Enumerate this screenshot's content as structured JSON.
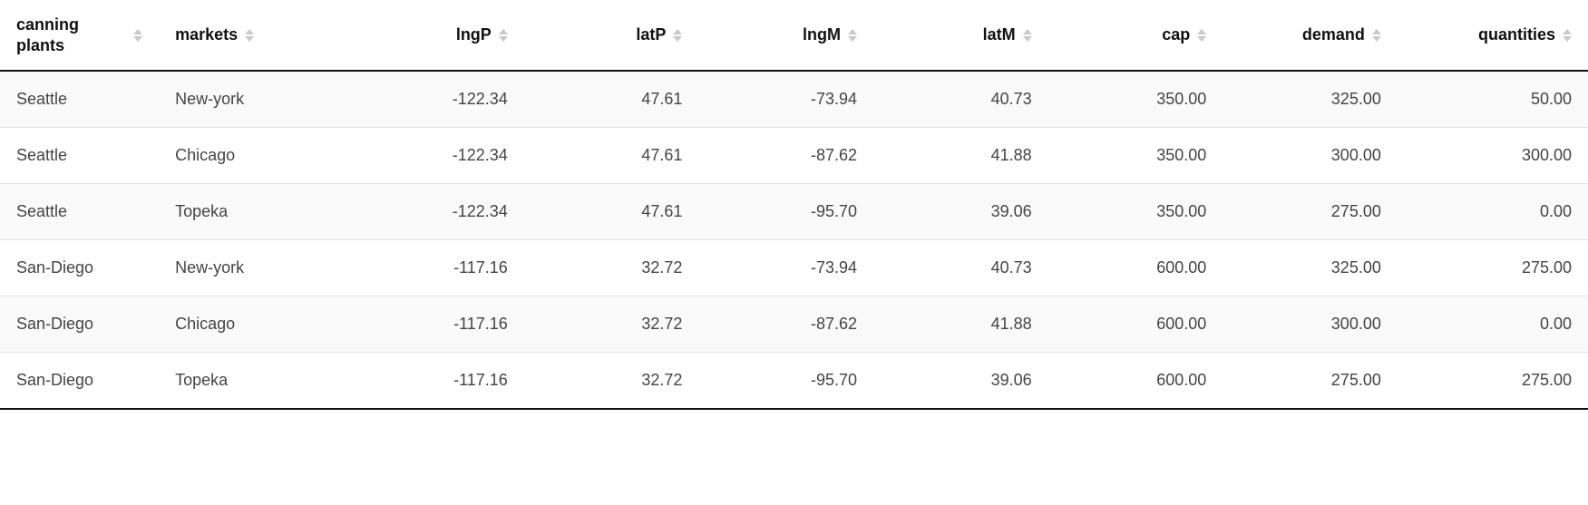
{
  "table": {
    "columns": [
      {
        "key": "canning_plants",
        "label": "canning plants",
        "type": "text"
      },
      {
        "key": "markets",
        "label": "markets",
        "type": "text"
      },
      {
        "key": "lngP",
        "label": "lngP",
        "type": "num"
      },
      {
        "key": "latP",
        "label": "latP",
        "type": "num"
      },
      {
        "key": "lngM",
        "label": "lngM",
        "type": "num"
      },
      {
        "key": "latM",
        "label": "latM",
        "type": "num"
      },
      {
        "key": "cap",
        "label": "cap",
        "type": "num"
      },
      {
        "key": "demand",
        "label": "demand",
        "type": "num"
      },
      {
        "key": "quantities",
        "label": "quantities",
        "type": "num"
      }
    ],
    "rows": [
      {
        "canning_plants": "Seattle",
        "markets": "New-york",
        "lngP": "-122.34",
        "latP": "47.61",
        "lngM": "-73.94",
        "latM": "40.73",
        "cap": "350.00",
        "demand": "325.00",
        "quantities": "50.00"
      },
      {
        "canning_plants": "Seattle",
        "markets": "Chicago",
        "lngP": "-122.34",
        "latP": "47.61",
        "lngM": "-87.62",
        "latM": "41.88",
        "cap": "350.00",
        "demand": "300.00",
        "quantities": "300.00"
      },
      {
        "canning_plants": "Seattle",
        "markets": "Topeka",
        "lngP": "-122.34",
        "latP": "47.61",
        "lngM": "-95.70",
        "latM": "39.06",
        "cap": "350.00",
        "demand": "275.00",
        "quantities": "0.00"
      },
      {
        "canning_plants": "San-Diego",
        "markets": "New-york",
        "lngP": "-117.16",
        "latP": "32.72",
        "lngM": "-73.94",
        "latM": "40.73",
        "cap": "600.00",
        "demand": "325.00",
        "quantities": "275.00"
      },
      {
        "canning_plants": "San-Diego",
        "markets": "Chicago",
        "lngP": "-117.16",
        "latP": "32.72",
        "lngM": "-87.62",
        "latM": "41.88",
        "cap": "600.00",
        "demand": "300.00",
        "quantities": "0.00"
      },
      {
        "canning_plants": "San-Diego",
        "markets": "Topeka",
        "lngP": "-117.16",
        "latP": "32.72",
        "lngM": "-95.70",
        "latM": "39.06",
        "cap": "600.00",
        "demand": "275.00",
        "quantities": "275.00"
      }
    ]
  }
}
